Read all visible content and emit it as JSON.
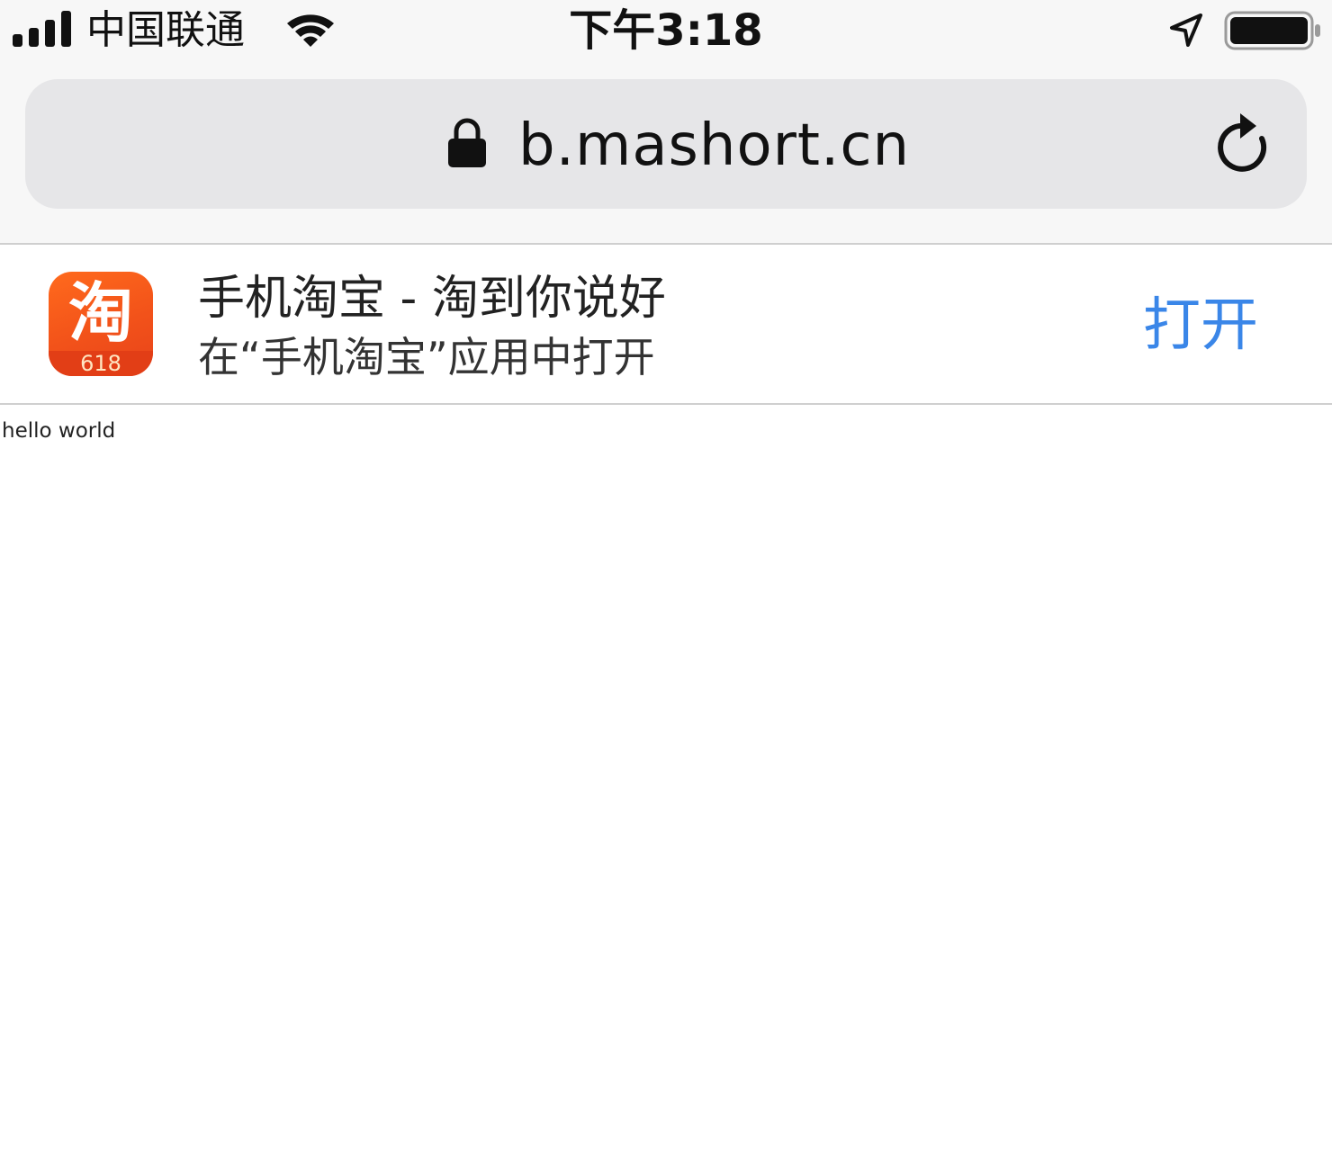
{
  "status_bar": {
    "carrier": "中国联通",
    "time": "下午3:18",
    "signal_icon": "cellular-signal-icon",
    "wifi_icon": "wifi-icon",
    "location_icon": "location-arrow-icon",
    "battery_icon": "battery-full-icon"
  },
  "address_bar": {
    "url": "b.mashort.cn",
    "secure_icon": "lock-icon",
    "reload_icon": "reload-icon"
  },
  "app_banner": {
    "icon_glyph": "淘",
    "icon_badge": "618",
    "title": "手机淘宝 - 淘到你说好",
    "subtitle": "在“手机淘宝”应用中打开",
    "open_label": "打开",
    "accent_color": "#3a86e8",
    "icon_color": "#f2521a"
  },
  "page": {
    "body_text": "hello world"
  }
}
